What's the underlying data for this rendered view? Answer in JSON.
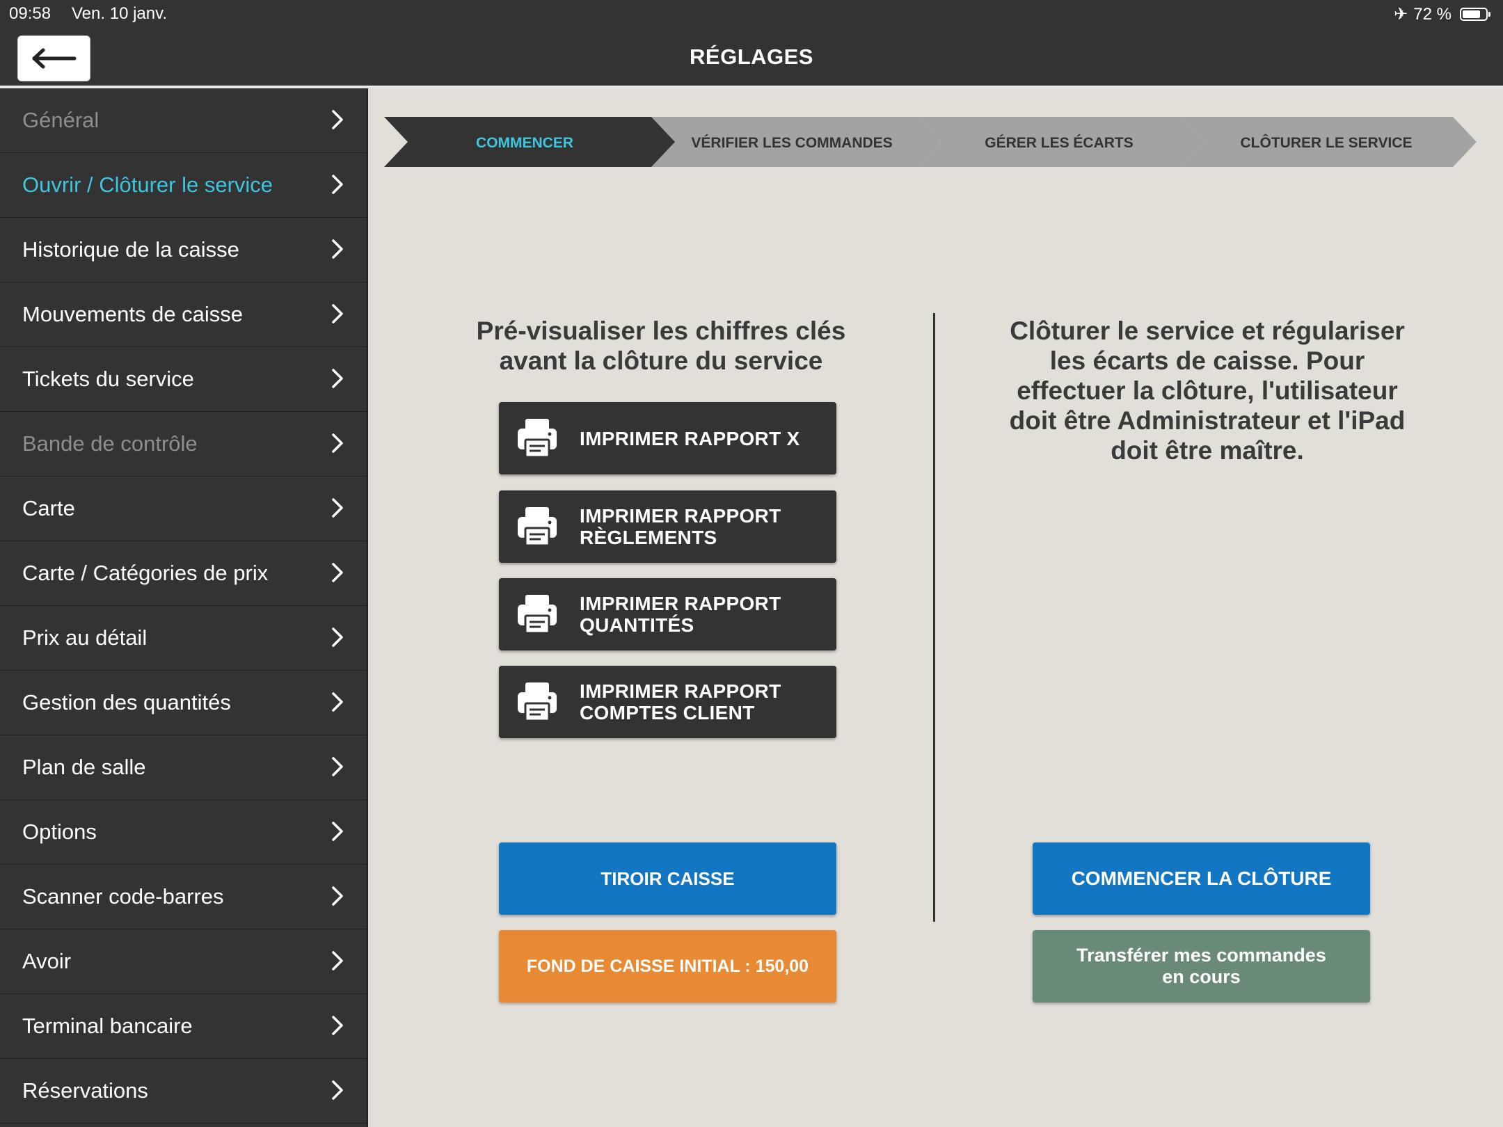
{
  "status": {
    "time": "09:58",
    "date": "Ven. 10 janv.",
    "battery": "72 %"
  },
  "header": {
    "title": "RÉGLAGES",
    "back_icon": "arrow-left-icon"
  },
  "sidebar": {
    "items": [
      {
        "label": "Général",
        "state": "disabled"
      },
      {
        "label": "Ouvrir / Clôturer le service",
        "state": "active"
      },
      {
        "label": "Historique de la caisse",
        "state": "normal"
      },
      {
        "label": "Mouvements de caisse",
        "state": "normal"
      },
      {
        "label": "Tickets du service",
        "state": "normal"
      },
      {
        "label": "Bande de contrôle",
        "state": "disabled"
      },
      {
        "label": "Carte",
        "state": "normal"
      },
      {
        "label": "Carte / Catégories de prix",
        "state": "normal"
      },
      {
        "label": "Prix au détail",
        "state": "normal"
      },
      {
        "label": "Gestion des quantités",
        "state": "normal"
      },
      {
        "label": "Plan de salle",
        "state": "normal"
      },
      {
        "label": "Options",
        "state": "normal"
      },
      {
        "label": "Scanner code-barres",
        "state": "normal"
      },
      {
        "label": "Avoir",
        "state": "normal"
      },
      {
        "label": "Terminal bancaire",
        "state": "normal"
      },
      {
        "label": "Réservations",
        "state": "normal"
      }
    ]
  },
  "stepper": {
    "steps": [
      {
        "label": "COMMENCER",
        "active": true
      },
      {
        "label": "VÉRIFIER LES COMMANDES",
        "active": false
      },
      {
        "label": "GÉRER LES ÉCARTS",
        "active": false
      },
      {
        "label": "CLÔTURER LE SERVICE",
        "active": false
      }
    ]
  },
  "left_panel": {
    "title_line1": "Pré-visualiser les chiffres clés",
    "title_line2": "avant la clôture du service",
    "reports": [
      {
        "line1": "IMPRIMER RAPPORT X",
        "line2": ""
      },
      {
        "line1": "IMPRIMER RAPPORT",
        "line2": "RÈGLEMENTS"
      },
      {
        "line1": "IMPRIMER RAPPORT",
        "line2": "QUANTITÉS"
      },
      {
        "line1": "IMPRIMER RAPPORT",
        "line2": "COMPTES CLIENT"
      }
    ],
    "drawer_button": "TIROIR CAISSE",
    "float_button": "FOND DE CAISSE INITIAL : 150,00"
  },
  "right_panel": {
    "lines": [
      "Clôturer le service et régulariser",
      "les écarts de caisse. Pour",
      "effectuer la clôture, l'utilisateur",
      "doit être Administrateur et l'iPad",
      "doit être maître."
    ],
    "start_button": "COMMENCER LA CLÔTURE",
    "transfer_line1": "Transférer mes commandes",
    "transfer_line2": "en cours"
  },
  "colors": {
    "dark": "#333333",
    "accent_cyan": "#3dc6dd",
    "blue": "#1276c2",
    "orange": "#e88a33",
    "green": "#6a8a78",
    "background": "#e2ded8"
  }
}
